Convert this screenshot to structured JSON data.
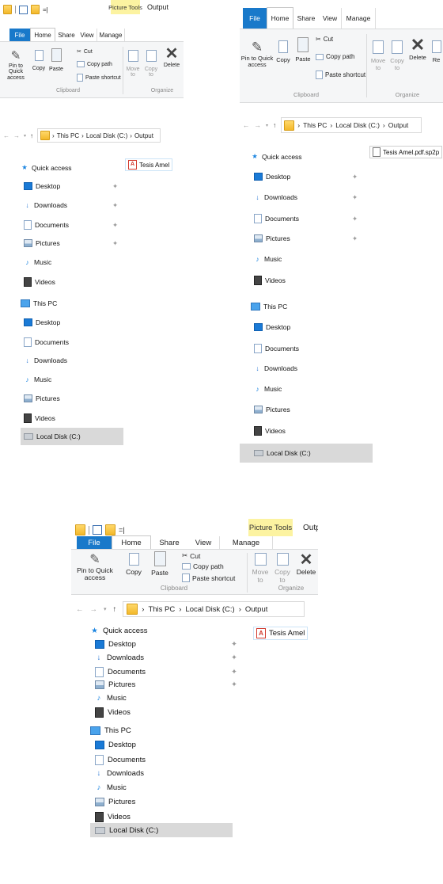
{
  "qat": {
    "separator": "|",
    "dropdown_glyph": "=|"
  },
  "tabs": {
    "file": "File",
    "home": "Home",
    "share": "Share",
    "view": "View",
    "manage": "Manage"
  },
  "context": {
    "picture_tools": "Picture Tools",
    "title": "Output"
  },
  "ribbon": {
    "pin": "Pin to Quick access",
    "copy": "Copy",
    "paste": "Paste",
    "cut": "Cut",
    "copy_path": "Copy path",
    "paste_shortcut": "Paste shortcut",
    "clipboard": "Clipboard",
    "move_to": "Move to",
    "copy_to": "Copy to",
    "delete": "Delete",
    "organize": "Organize",
    "rename_partial": "Re"
  },
  "address": {
    "this_pc": "This PC",
    "disk": "Local Disk (C:)",
    "output": "Output",
    "sep": "›"
  },
  "nav": {
    "quick_access": "Quick access",
    "desktop": "Desktop",
    "downloads": "Downloads",
    "documents": "Documents",
    "pictures": "Pictures",
    "music": "Music",
    "videos": "Videos",
    "this_pc": "This PC",
    "local_disk": "Local Disk (C:)"
  },
  "files": {
    "p1": "Tesis Amel",
    "p2": "Tesis Amel.pdf.sp2p",
    "p3": "Tesis Amel"
  },
  "icons": [
    "folder-icon",
    "checkbox-icon",
    "pin-icon",
    "copy-icon",
    "paste-icon",
    "cut-icon",
    "copy-path-icon",
    "paste-shortcut-icon",
    "move-to-icon",
    "copy-to-icon",
    "delete-icon",
    "back-arrow-icon",
    "forward-arrow-icon",
    "recent-chevron-icon",
    "up-arrow-icon",
    "star-icon",
    "desktop-icon",
    "downloads-icon",
    "documents-icon",
    "pictures-icon",
    "music-icon",
    "videos-icon",
    "this-pc-icon",
    "drive-icon",
    "pdf-icon",
    "file-icon"
  ],
  "colors": {
    "file_tab": "#1979ca",
    "picture_tools": "#fcf3a1",
    "selected": "#d9d9d9",
    "pdf": "#d23a2e"
  }
}
